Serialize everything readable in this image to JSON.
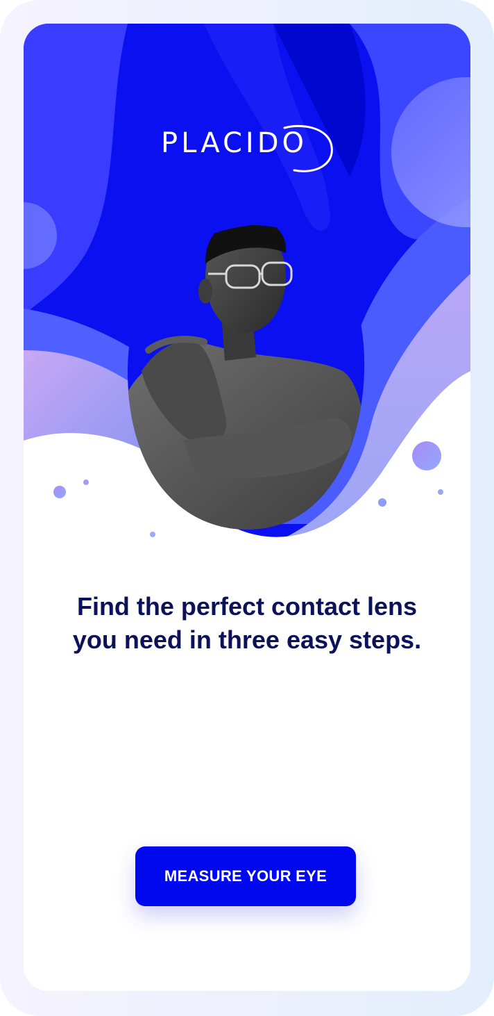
{
  "brand": {
    "name": "PLACIDO",
    "primary_color": "#0008ee",
    "text_color": "#0c1259"
  },
  "onboarding": {
    "headline": "Find the perfect contact lens you need in three easy steps.",
    "cta_label": "MEASURE YOUR EYE"
  },
  "hero": {
    "image": "man-with-glasses-portrait"
  }
}
